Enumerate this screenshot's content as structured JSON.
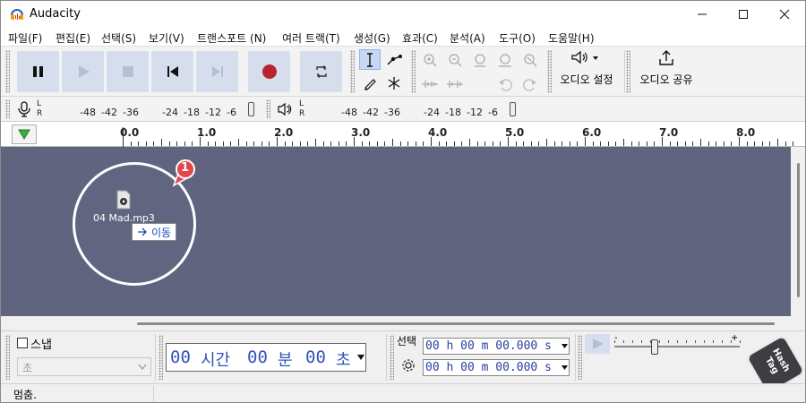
{
  "window": {
    "title": "Audacity"
  },
  "menu": [
    "파일(F)",
    "편집(E)",
    "선택(S)",
    "보기(V)",
    "트랜스포트 (N)",
    "여러 트랙(T)",
    "생성(G)",
    "효과(C)",
    "분석(A)",
    "도구(O)",
    "도움말(H)"
  ],
  "toolbar": {
    "audio_setup_label": "오디오 설정",
    "share_audio_label": "오디오 공유"
  },
  "meters": {
    "record_ticks": [
      "-48",
      "-42",
      "-36",
      "-24",
      "-18",
      "-12",
      "-6"
    ],
    "play_ticks": [
      "-48",
      "-42",
      "-36",
      "-24",
      "-18",
      "-12",
      "-6"
    ],
    "lr": [
      "L",
      "R"
    ]
  },
  "ruler": {
    "labels": [
      "0.0",
      "1.0",
      "2.0",
      "3.0",
      "4.0",
      "5.0",
      "6.0",
      "7.0",
      "8.0"
    ]
  },
  "drop": {
    "filename": "04  Mad.mp3",
    "action_label": "이동",
    "badge": "1"
  },
  "bottom": {
    "snap_label": "스냅",
    "snap_unit": "초",
    "time_h": "00",
    "time_h_unit": "시간",
    "time_m": "00",
    "time_m_unit": "분",
    "time_s": "00",
    "time_s_unit": "초",
    "selection_label": "선택",
    "sel_start": "00 h 00 m 00.000 s",
    "sel_end": "00 h 00 m 00.000 s",
    "speed_min": "-",
    "speed_max": "+",
    "speed_level": 0.32
  },
  "status": {
    "text": "멈춤."
  },
  "watermark": {
    "text": "Hash Tag"
  },
  "colors": {
    "track_bg": "#61647f",
    "record_red": "#b8232f",
    "time_blue": "#3055b8",
    "badge_red": "#e0484d"
  }
}
